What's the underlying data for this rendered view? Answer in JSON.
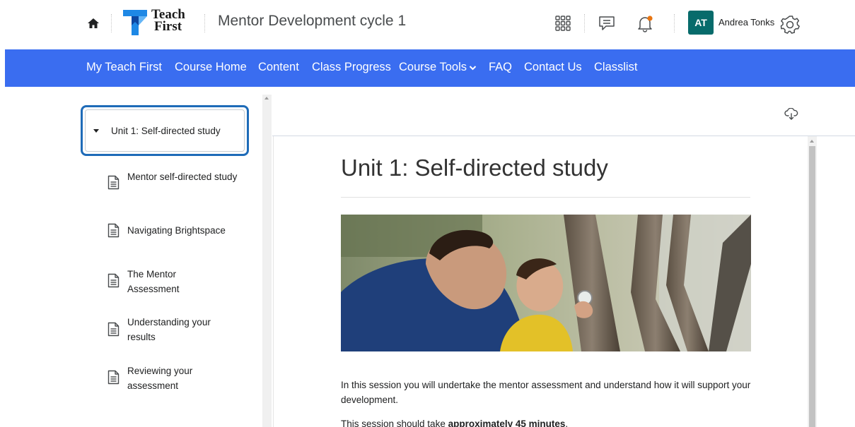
{
  "header": {
    "logo_text_line1": "Teach",
    "logo_text_line2": "First",
    "course_title": "Mentor Development cycle 1",
    "user_initials": "AT",
    "user_name": "Andrea Tonks",
    "notification_dot_color": "#e87511",
    "icons": [
      "home-icon",
      "waffle-icon",
      "message-icon",
      "bell-icon",
      "gear-icon"
    ]
  },
  "nav": {
    "items": [
      "My Teach First",
      "Course Home",
      "Content",
      "Class Progress",
      "Course Tools",
      "FAQ",
      "Contact Us",
      "Classlist"
    ],
    "background": "#3a6df0"
  },
  "toc": {
    "unit_label": "Unit 1: Self-directed study",
    "items": [
      "Mentor self-directed study",
      "Navigating Brightspace",
      "The Mentor Assessment",
      "Understanding your results",
      "Reviewing your assessment"
    ]
  },
  "content": {
    "title": "Unit 1: Self-directed study",
    "intro": "In this session you will undertake the mentor assessment and understand how it will support your development.",
    "duration_prefix": "This session should take ",
    "duration_bold": "approximately 45 minutes",
    "duration_suffix": "."
  }
}
